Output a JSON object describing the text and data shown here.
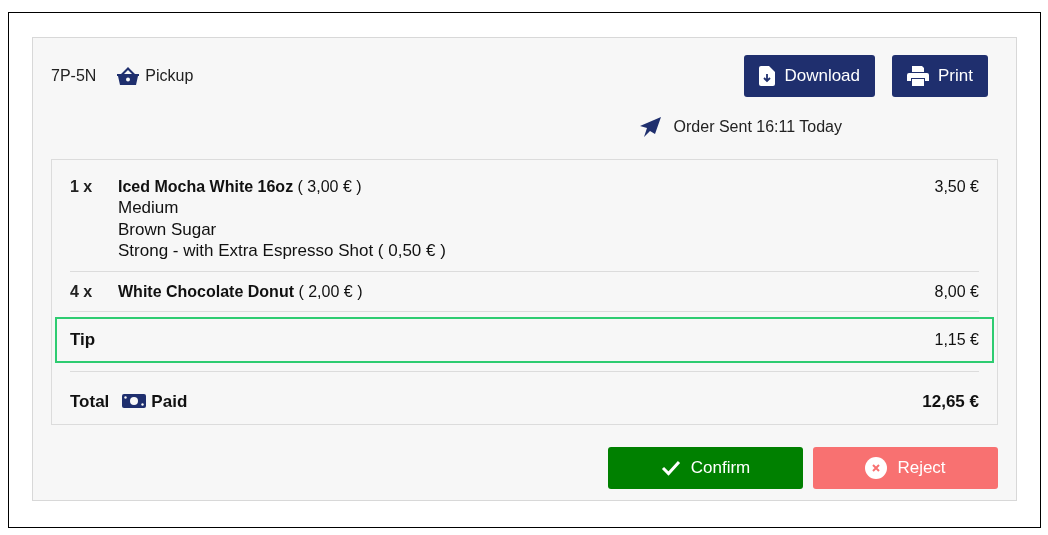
{
  "order": {
    "code": "7P-5N",
    "type": "Pickup"
  },
  "actions": [
    {
      "kind": "download",
      "label": "Download"
    },
    {
      "kind": "print",
      "label": "Print"
    }
  ],
  "status": "Order Sent 16:11 Today",
  "items": [
    {
      "quantity": "1 x",
      "name": "**Iced Mocha White 16oz** ( 3,00 € )",
      "options": [
        "Medium",
        "Brown Sugar",
        "Strong - with Extra Espresso Shot ( 0,50 € )"
      ],
      "price": "3,50 €"
    },
    {
      "quantity": "4 x",
      "name": "**White Chocolate Donut** ( 2,00 € )",
      "price": "8,00 €"
    }
  ],
  "tip": {
    "label": "Tip",
    "amount": "1,15 €",
    "highlighted": true
  },
  "total": {
    "label": "Total",
    "payment": "Paid",
    "amount": "12,65 €"
  },
  "buttons": [
    {
      "kind": "confirm",
      "label": "Confirm"
    },
    {
      "kind": "reject",
      "label": "Reject"
    }
  ]
}
